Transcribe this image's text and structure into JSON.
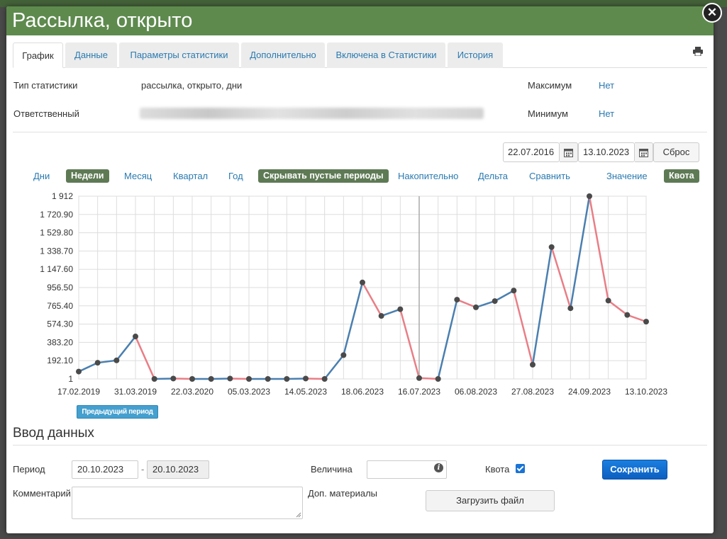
{
  "window": {
    "title": "Рассылка, открыто"
  },
  "tabs": [
    {
      "label": "График",
      "active": true
    },
    {
      "label": "Данные"
    },
    {
      "label": "Параметры статистики"
    },
    {
      "label": "Дополнительно"
    },
    {
      "label": "Включена в Статистики"
    },
    {
      "label": "История"
    }
  ],
  "info": {
    "type_label": "Тип статистики",
    "type_value": "рассылка, открыто, дни",
    "responsible_label": "Ответственный",
    "max_label": "Максимум",
    "max_value": "Нет",
    "min_label": "Минимум",
    "min_value": "Нет"
  },
  "filters": {
    "date_from": "22.07.2016",
    "date_to": "13.10.2023",
    "reset_label": "Сброс"
  },
  "options": {
    "days": "Дни",
    "weeks": "Недели",
    "month": "Месяц",
    "quarter": "Квартал",
    "year": "Год",
    "hide_empty": "Скрывать пустые периоды",
    "cumulative": "Накопительно",
    "delta": "Дельта",
    "compare": "Сравнить",
    "value": "Значение",
    "quota": "Квота"
  },
  "chart_data": {
    "type": "line",
    "ylim": [
      1,
      1912
    ],
    "y_ticks": [
      "1",
      "192.10",
      "383.20",
      "574.30",
      "765.40",
      "956.50",
      "1 147.60",
      "1 338.70",
      "1 529.80",
      "1 720.90",
      "1 912"
    ],
    "x_tick_labels": [
      "17.02.2019",
      "31.03.2019",
      "22.03.2020",
      "05.03.2023",
      "14.05.2023",
      "18.06.2023",
      "16.07.2023",
      "06.08.2023",
      "27.08.2023",
      "24.09.2023",
      "13.10.2023"
    ],
    "values": [
      78,
      170,
      195,
      445,
      1,
      5,
      1,
      1,
      5,
      1,
      1,
      1,
      5,
      1,
      250,
      1010,
      660,
      730,
      10,
      1,
      830,
      750,
      815,
      925,
      150,
      1380,
      740,
      1912,
      820,
      670,
      600
    ],
    "colors": {
      "up": "#4a7fb0",
      "down": "#e97e86",
      "point": "#4a4a4a",
      "grid": "#dddddd"
    }
  },
  "prev_period_label": "Предыдущий период",
  "entry": {
    "title": "Ввод данных",
    "period_label": "Период",
    "period_from": "20.10.2023",
    "period_to": "20.10.2023",
    "value_label": "Величина",
    "value": "",
    "quota_label": "Квота",
    "quota_checked": true,
    "save_label": "Сохранить",
    "comment_label": "Комментарий",
    "materials_label": "Доп. материалы",
    "upload_label": "Загрузить файл"
  }
}
